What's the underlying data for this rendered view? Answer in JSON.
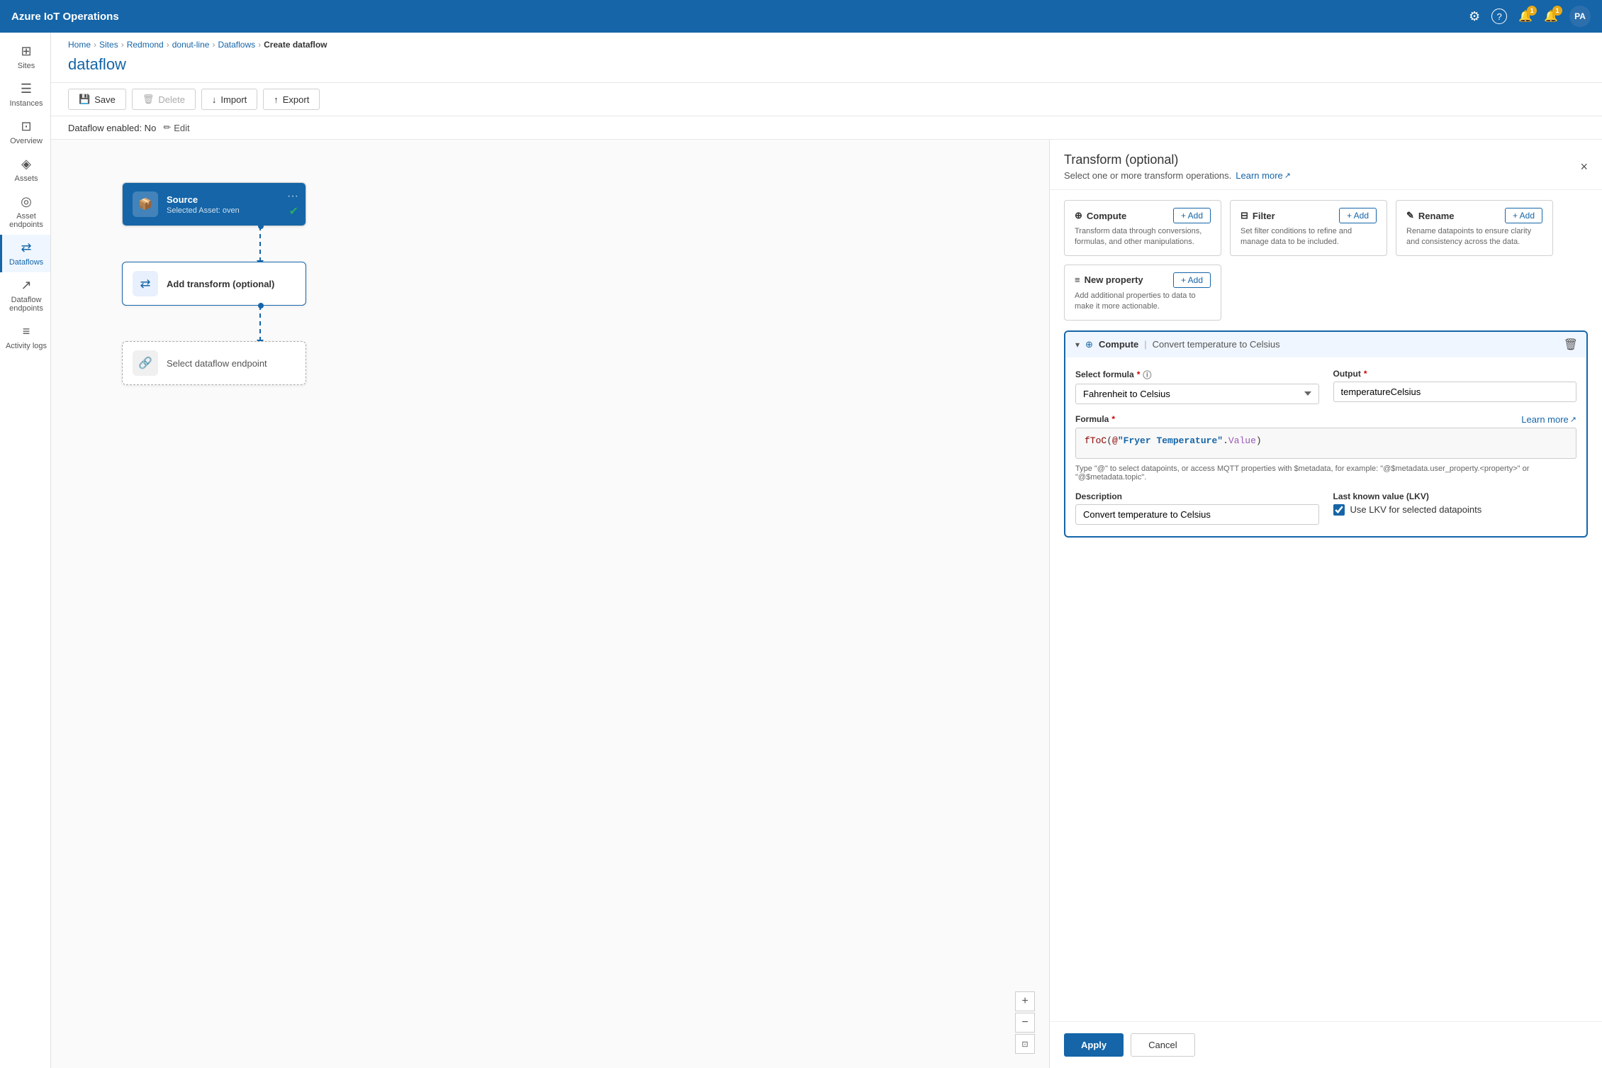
{
  "app": {
    "title": "Azure IoT Operations"
  },
  "topnav": {
    "title": "Azure IoT Operations",
    "icons": {
      "settings": "⚙",
      "help": "?",
      "alert1_label": "🔔",
      "alert1_badge": "1",
      "alert2_label": "🔔",
      "alert2_badge": "1"
    },
    "avatar": "PA"
  },
  "sidebar": {
    "items": [
      {
        "id": "sites",
        "icon": "⊞",
        "label": "Sites"
      },
      {
        "id": "instances",
        "icon": "☰",
        "label": "Instances"
      },
      {
        "id": "overview",
        "icon": "⊡",
        "label": "Overview"
      },
      {
        "id": "assets",
        "icon": "◈",
        "label": "Assets"
      },
      {
        "id": "asset-endpoints",
        "icon": "◎",
        "label": "Asset endpoints"
      },
      {
        "id": "dataflows",
        "icon": "⇄",
        "label": "Dataflows",
        "active": true
      },
      {
        "id": "dataflow-endpoints",
        "icon": "↗",
        "label": "Dataflow endpoints"
      },
      {
        "id": "activity-logs",
        "icon": "≡",
        "label": "Activity logs"
      }
    ]
  },
  "breadcrumb": {
    "parts": [
      "Home",
      "Sites",
      "Redmond",
      "donut-line",
      "Dataflows",
      "Create dataflow"
    ]
  },
  "page": {
    "title": "dataflow"
  },
  "toolbar": {
    "save_label": "Save",
    "delete_label": "Delete",
    "import_label": "Import",
    "export_label": "Export"
  },
  "status_bar": {
    "text": "Dataflow enabled: No",
    "edit_label": "Edit"
  },
  "flow": {
    "source": {
      "title": "Source",
      "subtitle": "Selected Asset: oven"
    },
    "transform": {
      "title": "Add transform (optional)"
    },
    "endpoint": {
      "title": "Select dataflow endpoint"
    }
  },
  "transform_panel": {
    "title": "Transform (optional)",
    "subtitle": "Select one or more transform operations.",
    "learn_more_label": "Learn more",
    "close_label": "×",
    "operations": [
      {
        "id": "compute",
        "icon": "⊕",
        "title": "Compute",
        "desc": "Transform data through conversions, formulas, and other manipulations.",
        "add_label": "+ Add"
      },
      {
        "id": "filter",
        "icon": "⊟",
        "title": "Filter",
        "desc": "Set filter conditions to refine and manage data to be included.",
        "add_label": "+ Add"
      },
      {
        "id": "rename",
        "icon": "✎",
        "title": "Rename",
        "desc": "Rename datapoints to ensure clarity and consistency across the data.",
        "add_label": "+ Add"
      },
      {
        "id": "new-property",
        "icon": "≡",
        "title": "New property",
        "desc": "Add additional properties to data to make it more actionable.",
        "add_label": "+ Add"
      }
    ],
    "compute_section": {
      "title": "Compute",
      "sep": "|",
      "subtitle": "Convert temperature to Celsius",
      "fields": {
        "select_formula_label": "Select formula",
        "select_formula_value": "Fahrenheit to Celsius",
        "output_label": "Output",
        "output_value": "temperatureCelsius",
        "formula_label": "Formula",
        "learn_more_label": "Learn more",
        "formula_text": "fToC(@\"Fryer Temperature\".Value)",
        "formula_hint": "Type \"@\" to select datapoints, or access MQTT properties with $metadata, for example: \"@$metadata.user_property.<property>\" or \"@$metadata.topic\".",
        "description_label": "Description",
        "description_value": "Convert temperature to Celsius",
        "lkv_label": "Last known value (LKV)",
        "lkv_checkbox_label": "Use LKV for selected datapoints",
        "lkv_checked": true
      }
    },
    "footer": {
      "apply_label": "Apply",
      "cancel_label": "Cancel"
    }
  }
}
